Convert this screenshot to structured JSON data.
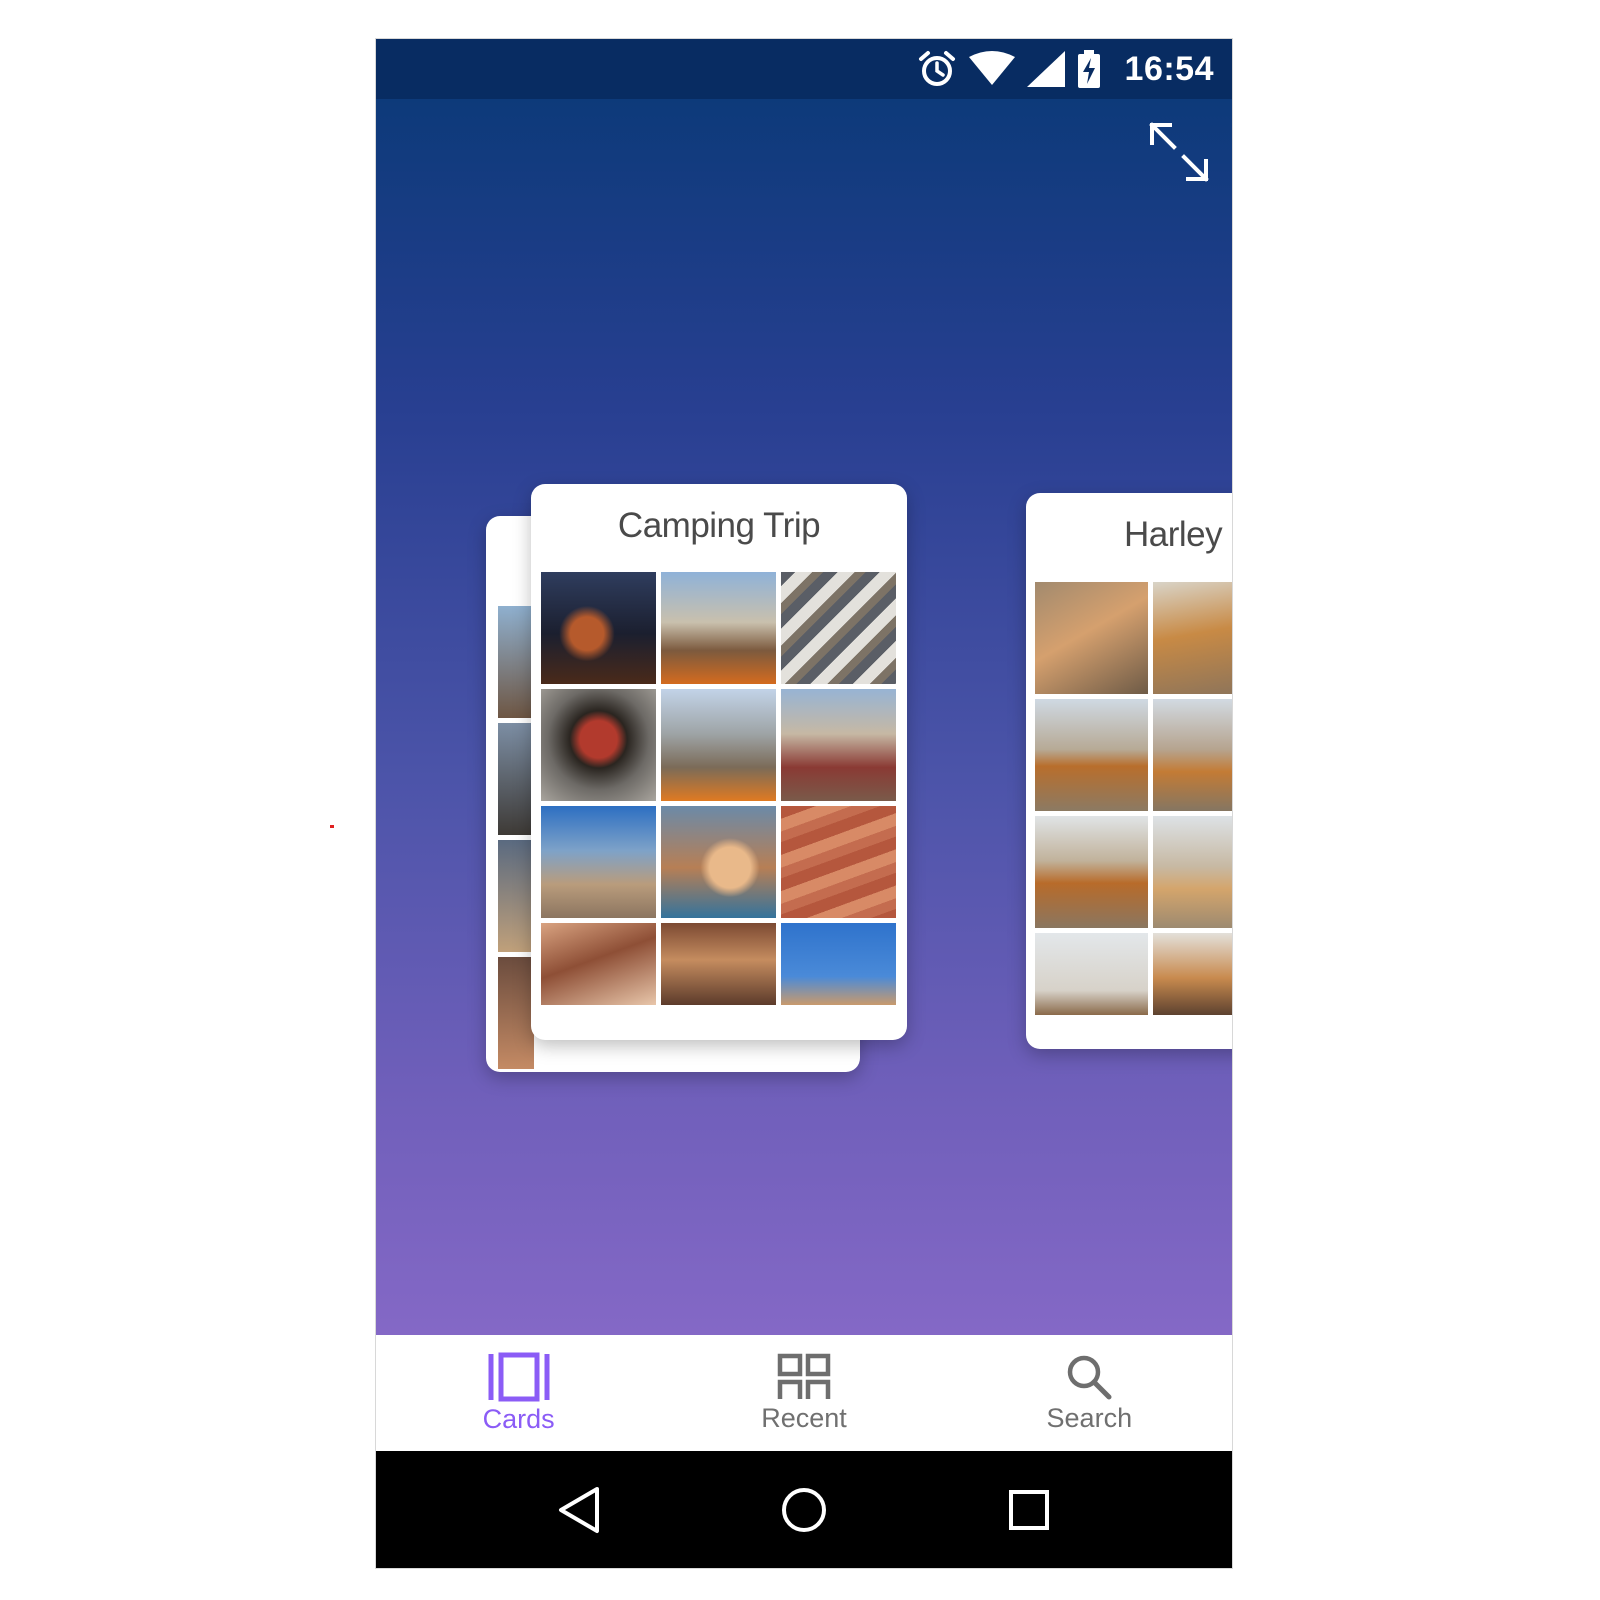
{
  "status_bar": {
    "time": "16:54",
    "icons": [
      "alarm-icon",
      "wifi-icon",
      "cell-signal-icon",
      "battery-charging-icon"
    ]
  },
  "top_actions": {
    "expand_icon": "expand-icon"
  },
  "colors": {
    "status_bar": "#082c62",
    "gradient_top": "#0d3a7a",
    "gradient_bottom": "#8468c6",
    "accent": "#8b5cf6",
    "nav_inactive": "#707070"
  },
  "cards": [
    {
      "title": "Camping Trip",
      "photo_count_visible": 12
    },
    {
      "title": "Harley c",
      "photo_count_visible": 8
    }
  ],
  "bottom_nav": {
    "items": [
      {
        "label": "Cards",
        "icon": "cards-icon",
        "active": true
      },
      {
        "label": "Recent",
        "icon": "recent-grid-icon",
        "active": false
      },
      {
        "label": "Search",
        "icon": "search-icon",
        "active": false
      }
    ]
  },
  "system_nav": {
    "icons": [
      "back-icon",
      "home-icon",
      "overview-icon"
    ]
  }
}
